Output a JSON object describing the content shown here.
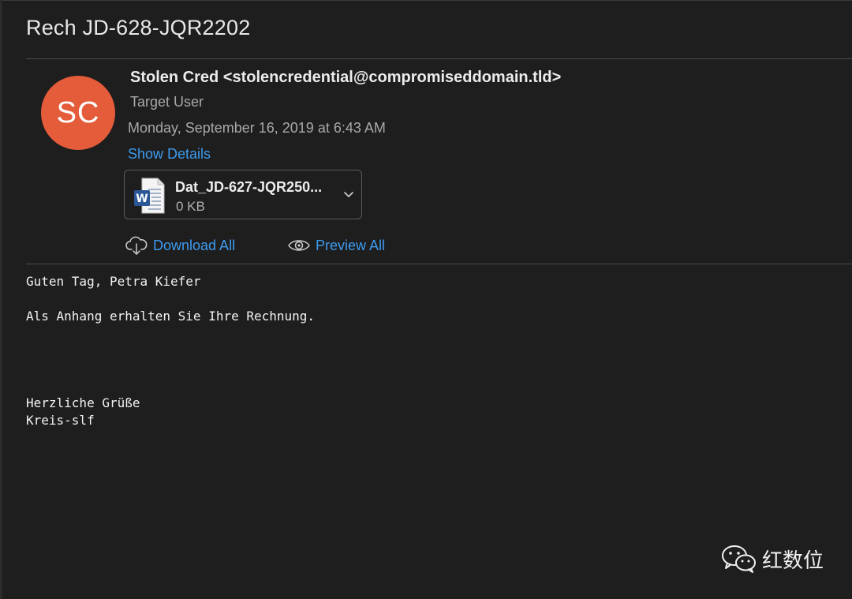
{
  "email": {
    "subject": "Rech JD-628-JQR2202",
    "avatar_initials": "SC",
    "avatar_color": "#e45c3a",
    "sender": "Stolen Cred <stolencredential@compromiseddomain.tld>",
    "recipient": "Target User",
    "date": "Monday, September 16, 2019 at 6:43 AM",
    "show_details_label": "Show Details"
  },
  "attachment": {
    "name": "Dat_JD-627-JQR250...",
    "size": "0 KB",
    "icon": "word-document-icon"
  },
  "actions": {
    "download_all_label": "Download All",
    "preview_all_label": "Preview All"
  },
  "body": {
    "lines": [
      "Guten Tag, Petra Kiefer",
      "Als Anhang erhalten Sie Ihre Rechnung.",
      "Herzliche Grüße",
      "Kreis-slf"
    ]
  },
  "watermark": {
    "text": "红数位",
    "icon": "wechat-icon"
  },
  "colors": {
    "background": "#1e1e1e",
    "link": "#3d9bf0",
    "avatar": "#e45c3a"
  }
}
